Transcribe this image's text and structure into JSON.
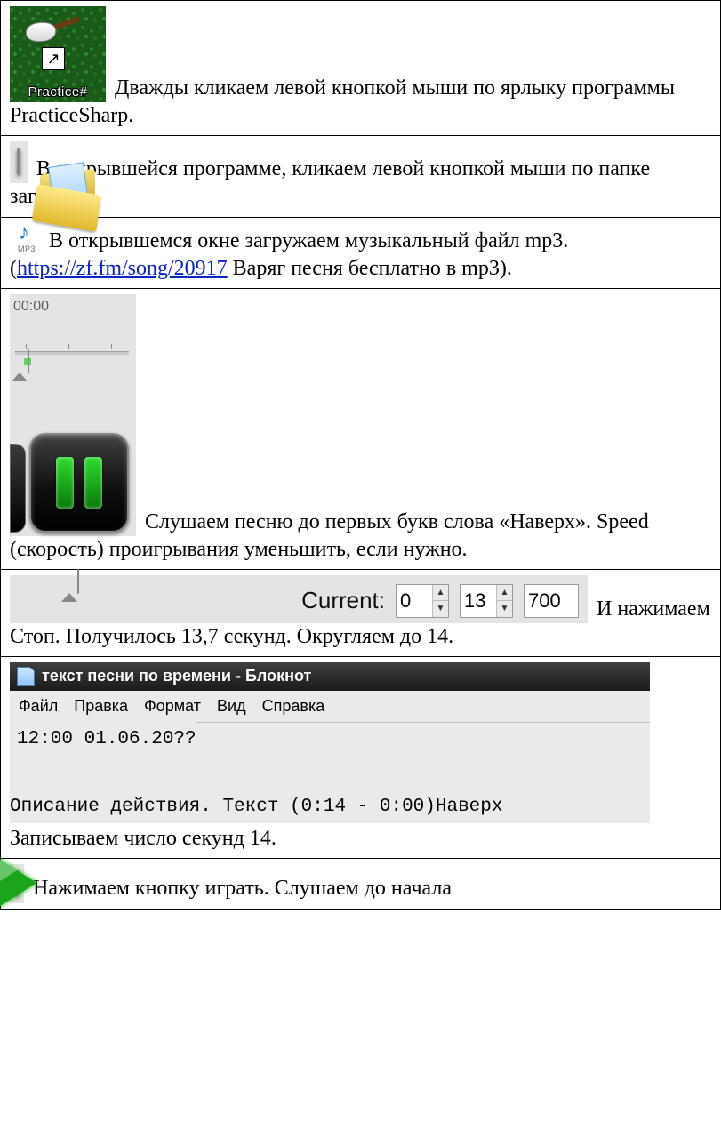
{
  "row1": {
    "shortcut_label": "Practice#",
    "text_a": " Дважды кликаем левой кнопкой мыши по ярлыку программы PracticeSharp."
  },
  "row2": {
    "text_a": " В открывшейся программе, кликаем левой кнопкой мыши по папке загрузки."
  },
  "row3": {
    "mp3_label": "MP3",
    "text_a": " В открывшемся окне загружаем музыкальный файл mp3. (",
    "link_text": "https://zf.fm/song/20917",
    "link_href": "https://zf.fm/song/20917",
    "text_b": "  Варяг песня бесплатно в mp3)."
  },
  "row4": {
    "time": "00:00",
    "text_a": " Слушаем песню до первых букв слова «Наверх». Speed (скорость) проигрывания уменьшить, если нужно."
  },
  "row5": {
    "label": "Current:",
    "val_a": "0",
    "val_b": "13",
    "val_c": "700",
    "text_a": " И нажимаем Стоп. Получилось 13,7 секунд. Округляем до 14."
  },
  "row6": {
    "title": "текст песни по времени - Блокнот",
    "menu": {
      "file": "Файл",
      "edit": "Правка",
      "format": "Формат",
      "view": "Вид",
      "help": "Справка"
    },
    "body_line1": "12:00 01.06.20??",
    "body_line2": "Описание действия. Текст (0:14 - 0:00)Наверх",
    "text_a": "Записываем число секунд 14."
  },
  "row7": {
    "text_a": " Нажимаем кнопку играть. Слушаем до начала"
  }
}
